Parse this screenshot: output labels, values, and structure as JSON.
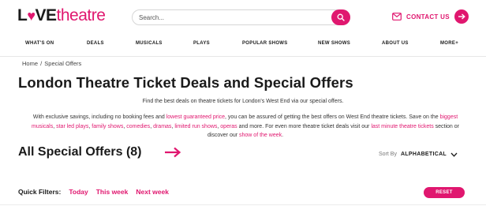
{
  "brand": {
    "part1": "L",
    "heart": "♥",
    "part2": "VE",
    "part3": "theatre",
    "accent": "#e0176f"
  },
  "search": {
    "placeholder": "Search...",
    "icon": "search-icon"
  },
  "contact": {
    "label": "CONTACT US",
    "icons": [
      "mail-icon",
      "arrow-right-icon"
    ]
  },
  "nav": {
    "items": [
      "WHAT'S ON",
      "DEALS",
      "MUSICALS",
      "PLAYS",
      "POPULAR SHOWS",
      "NEW SHOWS",
      "ABOUT US",
      "MORE+"
    ]
  },
  "breadcrumb": {
    "home": "Home",
    "separator": "/",
    "current": "Special Offers"
  },
  "page": {
    "title": "London Theatre Ticket Deals and Special Offers",
    "intro": "Find the best deals on theatre tickets for London's West End via our special offers."
  },
  "description": {
    "t1": "With exclusive savings, including no booking fees and ",
    "l1": "lowest guaranteed price",
    "t2": ", you can be assured of getting the best offers on West End theatre tickets. Save on the ",
    "l2": "biggest musicals",
    "t3": ", ",
    "l3": "star led plays",
    "t4": ", ",
    "l4": "family shows",
    "t5": ", ",
    "l5": "comedies",
    "t6": ", ",
    "l6": "dramas",
    "t7": ", ",
    "l7": "limited run shows",
    "t8": ", ",
    "l8": "operas",
    "t9": " and more. For even more theatre ticket deals visit our ",
    "l9": "last minute theatre tickets",
    "t10": " section or discover our ",
    "l10": "show of the week",
    "t11": "."
  },
  "offers": {
    "title": "All Special Offers (8)",
    "arrow_icon": "arrow-right-icon"
  },
  "sort": {
    "label": "Sort By",
    "value": "ALPHABETICAL",
    "icon": "chevron-down-icon"
  },
  "filters": {
    "label": "Quick Filters:",
    "options": [
      "Today",
      "This week",
      "Next week"
    ],
    "reset": "RESET"
  }
}
